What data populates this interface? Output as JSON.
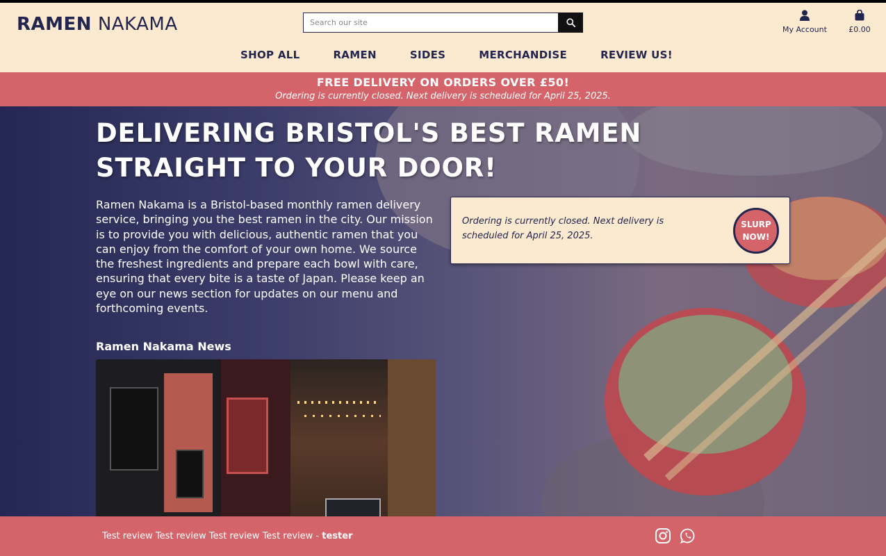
{
  "header": {
    "logo_bold": "RAMEN",
    "logo_light": "NAKAMA",
    "search_placeholder": "Search our site",
    "account_label": "My Account",
    "cart_total": "£0.00"
  },
  "nav": {
    "items": [
      {
        "label": "SHOP ALL"
      },
      {
        "label": "RAMEN"
      },
      {
        "label": "SIDES"
      },
      {
        "label": "MERCHANDISE"
      },
      {
        "label": "REVIEW US!"
      }
    ]
  },
  "promo": {
    "main": "FREE DELIVERY ON ORDERS OVER £50!",
    "sub": "Ordering is currently closed. Next delivery is scheduled for April 25, 2025."
  },
  "hero": {
    "title": "DELIVERING BRISTOL'S BEST RAMEN STRAIGHT TO YOUR DOOR!",
    "intro": "Ramen Nakama is a Bristol-based monthly ramen delivery service, bringing you the best ramen in the city. Our mission is to provide you with delicious, authentic ramen that you can enjoy from the comfort of your own home. We source the freshest ingredients and prepare each bowl with care, ensuring that every bite is a taste of Japan. Please keep an eye on our news section for updates on our menu and forthcoming events.",
    "order_message": "Ordering is currently closed. Next delivery is scheduled for April 25, 2025.",
    "cta_label": "SLURP NOW!"
  },
  "news": {
    "title": "Ramen Nakama News"
  },
  "footer": {
    "review_text": "Test review Test review Test review Test review - ",
    "review_author": "tester",
    "social_icons": [
      "instagram-icon",
      "whatsapp-icon"
    ]
  },
  "colors": {
    "navy": "#22254d",
    "cream": "#fbe9d0",
    "coral": "#d5646a"
  }
}
